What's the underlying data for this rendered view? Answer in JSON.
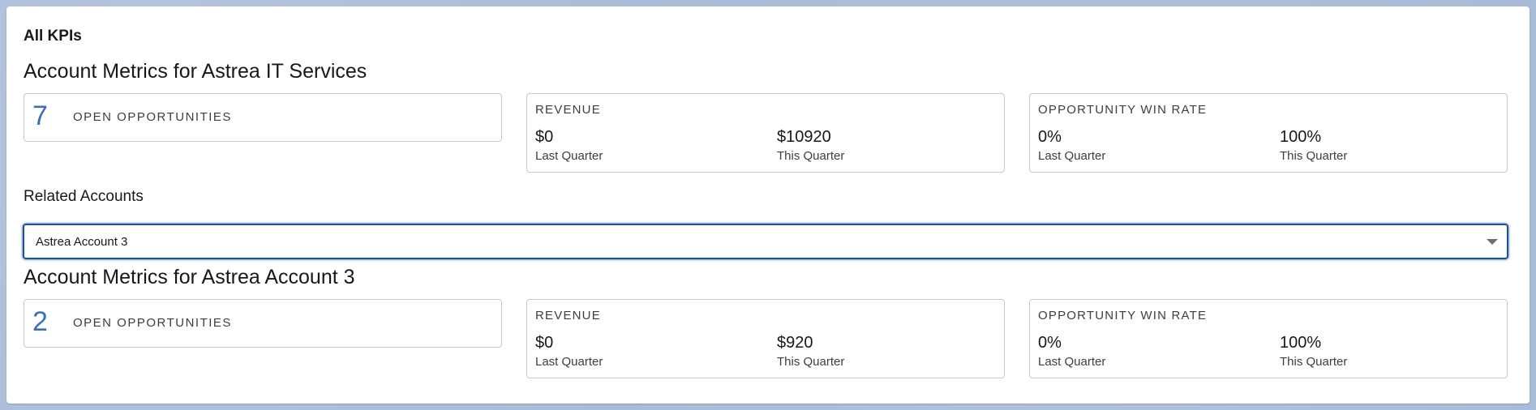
{
  "card": {
    "title": "All KPIs"
  },
  "primary": {
    "heading": "Account Metrics for Astrea IT Services",
    "open_opportunities": {
      "count": "7",
      "label": "OPEN OPPORTUNITIES"
    },
    "revenue": {
      "title": "REVENUE",
      "last_value": "$0",
      "last_label": "Last Quarter",
      "this_value": "$10920",
      "this_label": "This Quarter"
    },
    "win_rate": {
      "title": "OPPORTUNITY WIN RATE",
      "last_value": "0%",
      "last_label": "Last Quarter",
      "this_value": "100%",
      "this_label": "This Quarter"
    }
  },
  "related": {
    "label": "Related Accounts",
    "selected": "Astrea Account 3"
  },
  "secondary": {
    "heading": "Account Metrics for Astrea Account 3",
    "open_opportunities": {
      "count": "2",
      "label": "OPEN OPPORTUNITIES"
    },
    "revenue": {
      "title": "REVENUE",
      "last_value": "$0",
      "last_label": "Last Quarter",
      "this_value": "$920",
      "this_label": "This Quarter"
    },
    "win_rate": {
      "title": "OPPORTUNITY WIN RATE",
      "last_value": "0%",
      "last_label": "Last Quarter",
      "this_value": "100%",
      "this_label": "This Quarter"
    }
  },
  "icons": {
    "select_chevron": "chevron-down-icon"
  },
  "colors": {
    "accent": "#3b6fb6",
    "focus_border": "#1b5297"
  }
}
